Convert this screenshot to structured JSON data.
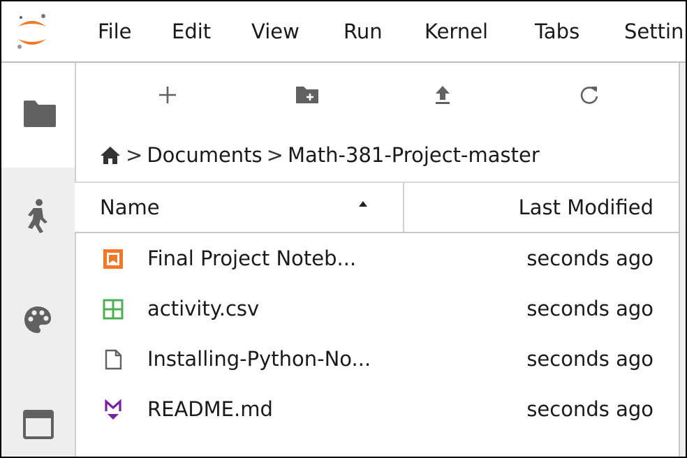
{
  "menubar": {
    "items": [
      "File",
      "Edit",
      "View",
      "Run",
      "Kernel",
      "Tabs",
      "Settin"
    ]
  },
  "toolbar": {
    "buttons": [
      {
        "icon": "plus-icon",
        "title": "New Launcher"
      },
      {
        "icon": "new-folder-icon",
        "title": "New Folder"
      },
      {
        "icon": "upload-icon",
        "title": "Upload Files"
      },
      {
        "icon": "refresh-icon",
        "title": "Refresh File List"
      }
    ]
  },
  "rail": {
    "icons": [
      "folder-icon",
      "running-icon",
      "palette-icon",
      "tabs-icon"
    ]
  },
  "breadcrumb": {
    "home_icon": "home-icon",
    "parts": [
      "Documents",
      "Math-381-Project-master"
    ],
    "separator": ">"
  },
  "table": {
    "columns": {
      "name": "Name",
      "modified": "Last Modified"
    },
    "sort": "ascending",
    "files": [
      {
        "name": "Final Project Noteb...",
        "modified": "seconds ago",
        "type": "notebook",
        "icon": "notebook-icon"
      },
      {
        "name": "activity.csv",
        "modified": "seconds ago",
        "type": "spreadsheet",
        "icon": "spreadsheet-icon"
      },
      {
        "name": "Installing-Python-No...",
        "modified": "seconds ago",
        "type": "file",
        "icon": "file-icon"
      },
      {
        "name": "README.md",
        "modified": "seconds ago",
        "type": "markdown",
        "icon": "markdown-icon"
      }
    ]
  },
  "colors": {
    "logo_orange": "#f37726",
    "notebook_orange": "#f37726",
    "csv_green": "#4caf50",
    "markdown_purple": "#7b1fa2",
    "icon_gray": "#616161"
  }
}
